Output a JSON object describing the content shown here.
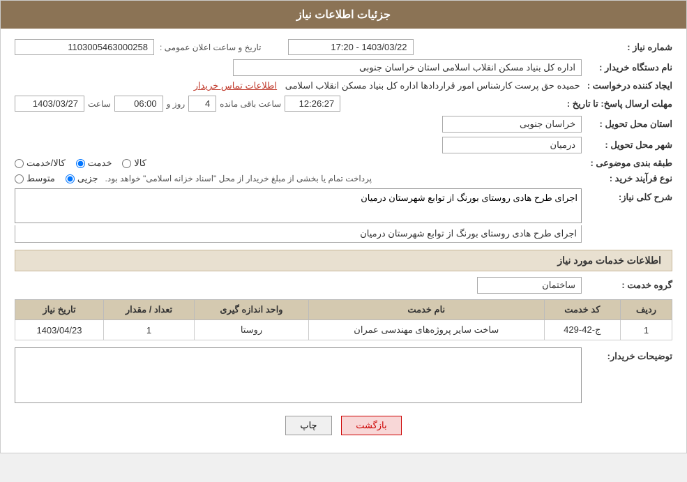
{
  "page": {
    "title": "جزئیات اطلاعات نیاز",
    "header_bg": "#8B7355"
  },
  "fields": {
    "shomara_niaz_label": "شماره نیاز :",
    "shomara_niaz_value": "1103005463000258",
    "nam_dastgah_label": "نام دستگاه خریدار :",
    "nam_dastgah_value": "اداره کل بنیاد مسکن انقلاب اسلامی استان خراسان جنوبی",
    "ijad_konande_label": "ایجاد کننده درخواست :",
    "ijad_konande_value": "حمیده حق پرست کارشناس امور قراردادها اداره کل بنیاد مسکن انقلاب اسلامی",
    "contact_link": "اطلاعات تماس خریدار",
    "mohlat_label": "مهلت ارسال پاسخ: تا تاریخ :",
    "date_value": "1403/03/27",
    "saat_label": "ساعت",
    "saat_value": "06:00",
    "roz_label": "روز و",
    "roz_value": "4",
    "remaining_label": "ساعت باقی مانده",
    "remaining_time": "12:26:27",
    "ostan_label": "استان محل تحویل :",
    "ostan_value": "خراسان جنوبی",
    "shahr_label": "شهر محل تحویل :",
    "shahr_value": "درمیان",
    "tabaqe_label": "طبقه بندی موضوعی :",
    "tabaqe_kala": "کالا",
    "tabaqe_khedmat": "خدمت",
    "tabaqe_kala_khedmat": "کالا/خدمت",
    "tabaqe_selected": "khedmat",
    "noeFarayand_label": "نوع فرآیند خرید :",
    "jozyi": "جزیی",
    "motavasset": "متوسط",
    "noeFarayand_note": "پرداخت تمام یا بخشی از مبلغ خریدار از محل \"اسناد خزانه اسلامی\" خواهد بود.",
    "sharh_label": "شرح کلی نیاز:",
    "sharh_value": "اجرای طرح هادی روستای بورنگ از توابع شهرستان درمیان",
    "services_section_title": "اطلاعات خدمات مورد نیاز",
    "group_label": "گروه خدمت :",
    "group_value": "ساختمان",
    "table": {
      "headers": [
        "ردیف",
        "کد خدمت",
        "نام خدمت",
        "واحد اندازه گیری",
        "تعداد / مقدار",
        "تاریخ نیاز"
      ],
      "rows": [
        {
          "radif": "1",
          "kod": "ج-42-429",
          "name": "ساخت سایر پروژه‌های مهندسی عمران",
          "vahed": "روستا",
          "tedad": "1",
          "tarikh": "1403/04/23"
        }
      ]
    },
    "toseeh_label": "توضیحات خریدار:",
    "toseeh_value": "",
    "btn_print": "چاپ",
    "btn_back": "بازگشت"
  }
}
